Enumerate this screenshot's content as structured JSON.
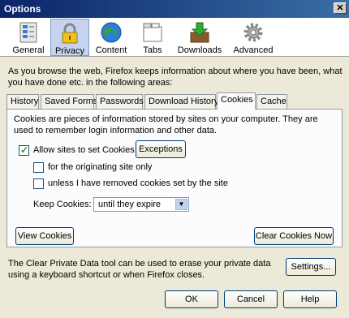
{
  "window": {
    "title": "Options",
    "close_glyph": "✕"
  },
  "toolbar": {
    "panes": [
      {
        "label": "General",
        "icon": "general-settings-icon",
        "selected": false
      },
      {
        "label": "Privacy",
        "icon": "lock-icon",
        "selected": true
      },
      {
        "label": "Content",
        "icon": "globe-icon",
        "selected": false
      },
      {
        "label": "Tabs",
        "icon": "tabs-icon",
        "selected": false
      },
      {
        "label": "Downloads",
        "icon": "downloads-box-icon",
        "selected": false
      },
      {
        "label": "Advanced",
        "icon": "gear-icon",
        "selected": false
      }
    ]
  },
  "privacy": {
    "description": "As you browse the web, Firefox keeps information about where you have been, what you have done etc. in the following areas:",
    "tabs": [
      "History",
      "Saved Forms",
      "Passwords",
      "Download History",
      "Cookies",
      "Cache"
    ],
    "active_tab": "Cookies",
    "cookies": {
      "description": "Cookies are pieces of information stored by sites on your computer. They are used to remember login information and other data.",
      "allow_label": "Allow sites to set Cookies",
      "allow_checked": true,
      "exceptions_label": "Exceptions",
      "originating_label": "for the originating site only",
      "originating_checked": false,
      "unless_removed_label": "unless I have removed cookies set by the site",
      "unless_removed_checked": false,
      "keep_label": "Keep Cookies:",
      "keep_value": "until they expire",
      "view_cookies_label": "View Cookies",
      "clear_cookies_label": "Clear Cookies Now"
    },
    "clear_private_data_text": "The Clear Private Data tool can be used to erase your private data using a keyboard shortcut or when Firefox closes.",
    "settings_label": "Settings..."
  },
  "footer": {
    "ok_label": "OK",
    "cancel_label": "Cancel",
    "help_label": "Help"
  },
  "colors": {
    "titlebar": "#0a246a",
    "dialog_bg": "#ece9d8",
    "selected_pane": "#c6d3f0",
    "check": "#21a121"
  }
}
